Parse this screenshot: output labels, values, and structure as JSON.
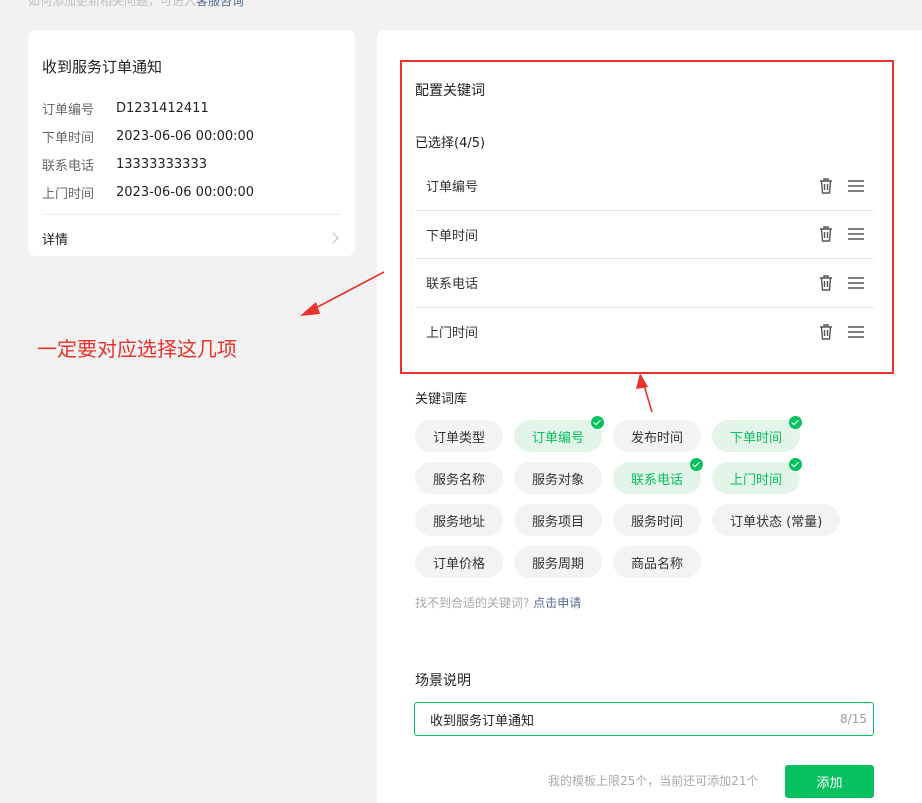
{
  "top_note": {
    "text": "如何添加更新相关问题，可进入",
    "link": "客服咨询"
  },
  "preview": {
    "title": "收到服务订单通知",
    "rows": [
      {
        "key": "订单编号",
        "value": "D1231412411"
      },
      {
        "key": "下单时间",
        "value": "2023-06-06 00:00:00"
      },
      {
        "key": "联系电话",
        "value": "13333333333"
      },
      {
        "key": "上门时间",
        "value": "2023-06-06 00:00:00"
      }
    ],
    "detail_label": "详情"
  },
  "annotation": {
    "text": "一定要对应选择这几项",
    "color": "#e8322b"
  },
  "config": {
    "title": "配置关键词",
    "selected_count": "已选择(4/5)",
    "selected": [
      "订单编号",
      "下单时间",
      "联系电话",
      "上门时间"
    ],
    "library_title": "关键词库",
    "library": [
      {
        "label": "订单类型",
        "selected": false
      },
      {
        "label": "订单编号",
        "selected": true
      },
      {
        "label": "发布时间",
        "selected": false
      },
      {
        "label": "下单时间",
        "selected": true
      },
      {
        "label": "服务名称",
        "selected": false
      },
      {
        "label": "服务对象",
        "selected": false
      },
      {
        "label": "联系电话",
        "selected": true
      },
      {
        "label": "上门时间",
        "selected": true
      },
      {
        "label": "服务地址",
        "selected": false
      },
      {
        "label": "服务项目",
        "selected": false
      },
      {
        "label": "服务时间",
        "selected": false
      },
      {
        "label": "订单状态 (常量)",
        "selected": false
      },
      {
        "label": "订单价格",
        "selected": false
      },
      {
        "label": "服务周期",
        "selected": false
      },
      {
        "label": "商品名称",
        "selected": false
      }
    ],
    "hint_text": "找不到合适的关键词?",
    "hint_link": "点击申请"
  },
  "scene": {
    "title": "场景说明",
    "value": "收到服务订单通知",
    "counter": "8/15"
  },
  "footer": {
    "limit_text": "我的模板上限25个，当前还可添加21个",
    "add_label": "添加"
  },
  "colors": {
    "accent": "#07c160",
    "annotation": "#e8322b",
    "link": "#576b95"
  }
}
